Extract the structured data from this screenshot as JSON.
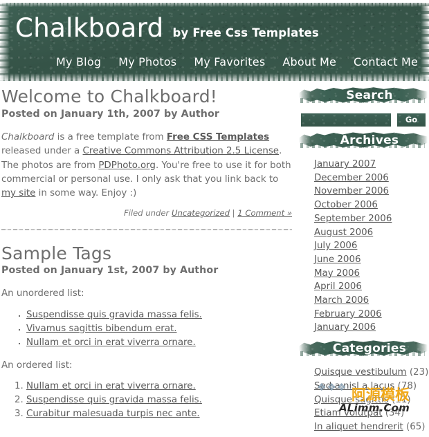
{
  "site": {
    "title": "Chalkboard",
    "tagline": "by Free Css Templates"
  },
  "colors": {
    "chalk_green": "#3a5c4e",
    "header_green": "#37584b",
    "body_text": "#6e6e6e",
    "link": "#5a5a5a",
    "banner_text": "#ffffff",
    "watermark_orange": "#f0a818"
  },
  "nav": {
    "items": [
      {
        "label": "My Blog"
      },
      {
        "label": "My Photos"
      },
      {
        "label": "My Favorites"
      },
      {
        "label": "About Me"
      },
      {
        "label": "Contact Me"
      }
    ]
  },
  "posts": [
    {
      "title": "Welcome to Chalkboard!",
      "meta": "Posted on January 1th, 2007 by Author",
      "body": {
        "lead_em": "Chalkboard",
        "text_1": " is a free template from ",
        "link_fct": "Free CSS Templates",
        "text_2": " released under a ",
        "link_license": "Creative Commons Attribution 2.5 License",
        "text_3": ". The photos are from ",
        "link_pdphoto": "PDPhoto.org",
        "text_4": ". You're free to use it for both commercial or personal use. I only ask that you link back to ",
        "link_mysite": "my site",
        "text_5": " in some way. Enjoy :)"
      },
      "footer": {
        "filed_under_label": "Filed under ",
        "category_link": "Uncategorized",
        "separator": " | ",
        "comments_link": "1 Comment »"
      }
    },
    {
      "title": "Sample Tags",
      "meta": "Posted on January 1st, 2007 by Author",
      "unordered_intro": "An unordered list:",
      "unordered_items": [
        "Suspendisse quis gravida massa felis.",
        "Vivamus sagittis bibendum erat.",
        "Nullam et orci in erat viverra ornare."
      ],
      "ordered_intro": "An ordered list:",
      "ordered_items": [
        "Nullam et orci in erat viverra ornare.",
        "Suspendisse quis gravida massa felis.",
        "Curabitur malesuada turpis nec ante."
      ]
    }
  ],
  "sidebar": {
    "search": {
      "title": "Search",
      "value": "",
      "placeholder": "",
      "button_label": "Go"
    },
    "archives": {
      "title": "Archives",
      "items": [
        "January 2007",
        "December 2006",
        "November 2006",
        "October 2006",
        "September 2006",
        "August 2006",
        "July 2006",
        "June 2006",
        "May 2006",
        "April 2006",
        "March 2006",
        "February 2006",
        "January 2006"
      ]
    },
    "categories": {
      "title": "Categories",
      "items": [
        {
          "label": "Quisque vestibulum",
          "count": "(23)"
        },
        {
          "label": "Sed a nisl a lacus",
          "count": "(78)"
        },
        {
          "label": "Quisque sagittis",
          "count": "(11)"
        },
        {
          "label": "Etiam volutpat",
          "count": "(34)"
        },
        {
          "label": "In aliquet hendrerit",
          "count": "(65)"
        }
      ]
    }
  },
  "watermark": {
    "diamonds": "❖❖❖",
    "cn_text": "阿源模板",
    "latin_text": "ALimm.Com"
  }
}
